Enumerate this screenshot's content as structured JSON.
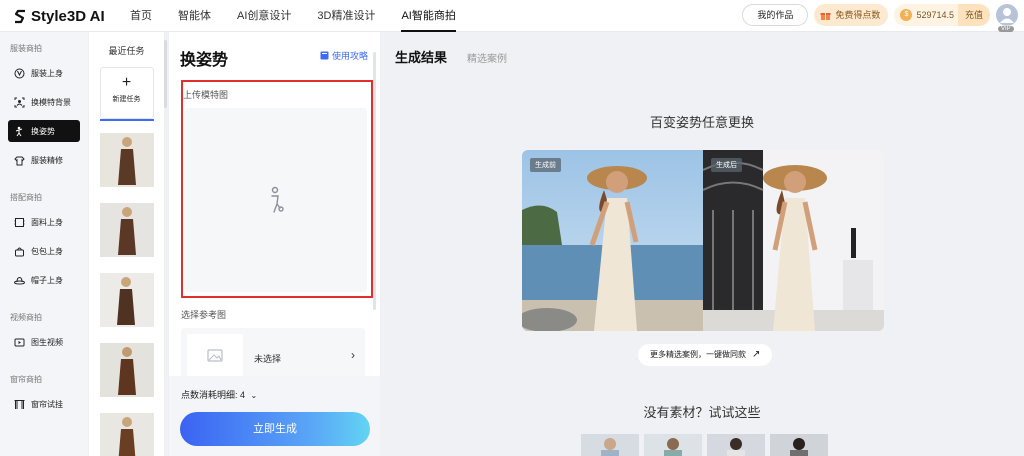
{
  "app": {
    "logo_text": "Style3D AI"
  },
  "nav": [
    {
      "label": "首页"
    },
    {
      "label": "智能体"
    },
    {
      "label": "AI创意设计"
    },
    {
      "label": "3D精准设计"
    },
    {
      "label": "AI智能商拍",
      "active": true
    }
  ],
  "topbar": {
    "works_label": "我的作品",
    "free_points_label": "免费得点数",
    "points_value": "529714.5",
    "recharge_label": "充值",
    "vip_label": "VIP"
  },
  "sidebar": {
    "sections": [
      {
        "title": "服装商拍",
        "items": [
          "服装上身",
          "换模特背景",
          "换姿势",
          "服装精修"
        ]
      },
      {
        "title": "搭配商拍",
        "items": [
          "面料上身",
          "包包上身",
          "帽子上身"
        ]
      },
      {
        "title": "视频商拍",
        "items": [
          "图生视频"
        ]
      },
      {
        "title": "窗帘商拍",
        "items": [
          "窗帘试挂"
        ]
      }
    ],
    "active_item": "换姿势"
  },
  "recent": {
    "title": "最近任务",
    "new_task_label": "新建任务"
  },
  "panel": {
    "title": "换姿势",
    "guide_label": "使用攻略",
    "upload_label": "上传模特图",
    "ref_label": "选择参考图",
    "ref_value": "未选择",
    "cost_label": "点数消耗明细: 4",
    "generate_label": "立即生成"
  },
  "content": {
    "tab_active": "生成结果",
    "tab_other": "精选案例",
    "headline": "百变姿势任意更换",
    "before_badge": "生成前",
    "after_badge": "生成后",
    "more_cases": "更多精选案例，一键做同款",
    "no_material": "没有素材？试试这些"
  },
  "colors": {
    "accent": "#3d6bf5",
    "highlight_border": "#e0302e",
    "active_nav": "#111111"
  }
}
